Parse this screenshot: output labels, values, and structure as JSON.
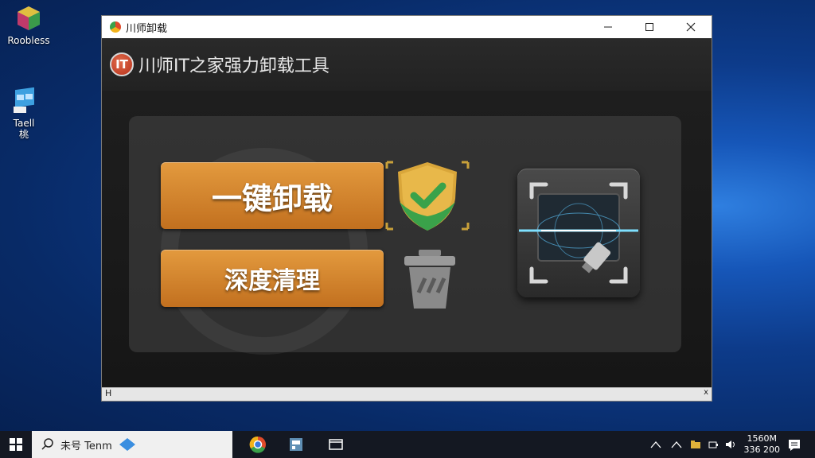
{
  "desktop": {
    "icons": [
      {
        "label": "Roobless",
        "icon": "cube-app-icon"
      },
      {
        "label": "Taell\n桃",
        "icon": "window-app-icon"
      }
    ]
  },
  "window": {
    "title": "川师卸载",
    "controls": {
      "minimize": "minimize-icon",
      "maximize": "maximize-icon",
      "close": "close-icon"
    }
  },
  "app": {
    "logo_text": "IT",
    "title": "川师IT之家强力卸载工具",
    "buttons": {
      "uninstall": "一键卸载",
      "deep_clean": "深度清理"
    },
    "icons": [
      "shield-check-icon",
      "trash-icon",
      "scan-icon"
    ]
  },
  "statusbar": {
    "left": "H",
    "right": "x"
  },
  "taskbar": {
    "search_text": "未号 Tenm",
    "pinned": [
      "edge-icon",
      "chrome-icon",
      "app-icon",
      "window-icon"
    ],
    "clock": {
      "time": "1560M",
      "date": "336 200"
    }
  },
  "colors": {
    "accent_orange": "#d4832d",
    "desktop_blue": "#0d3b8a",
    "window_dark": "#1b1b1b"
  }
}
